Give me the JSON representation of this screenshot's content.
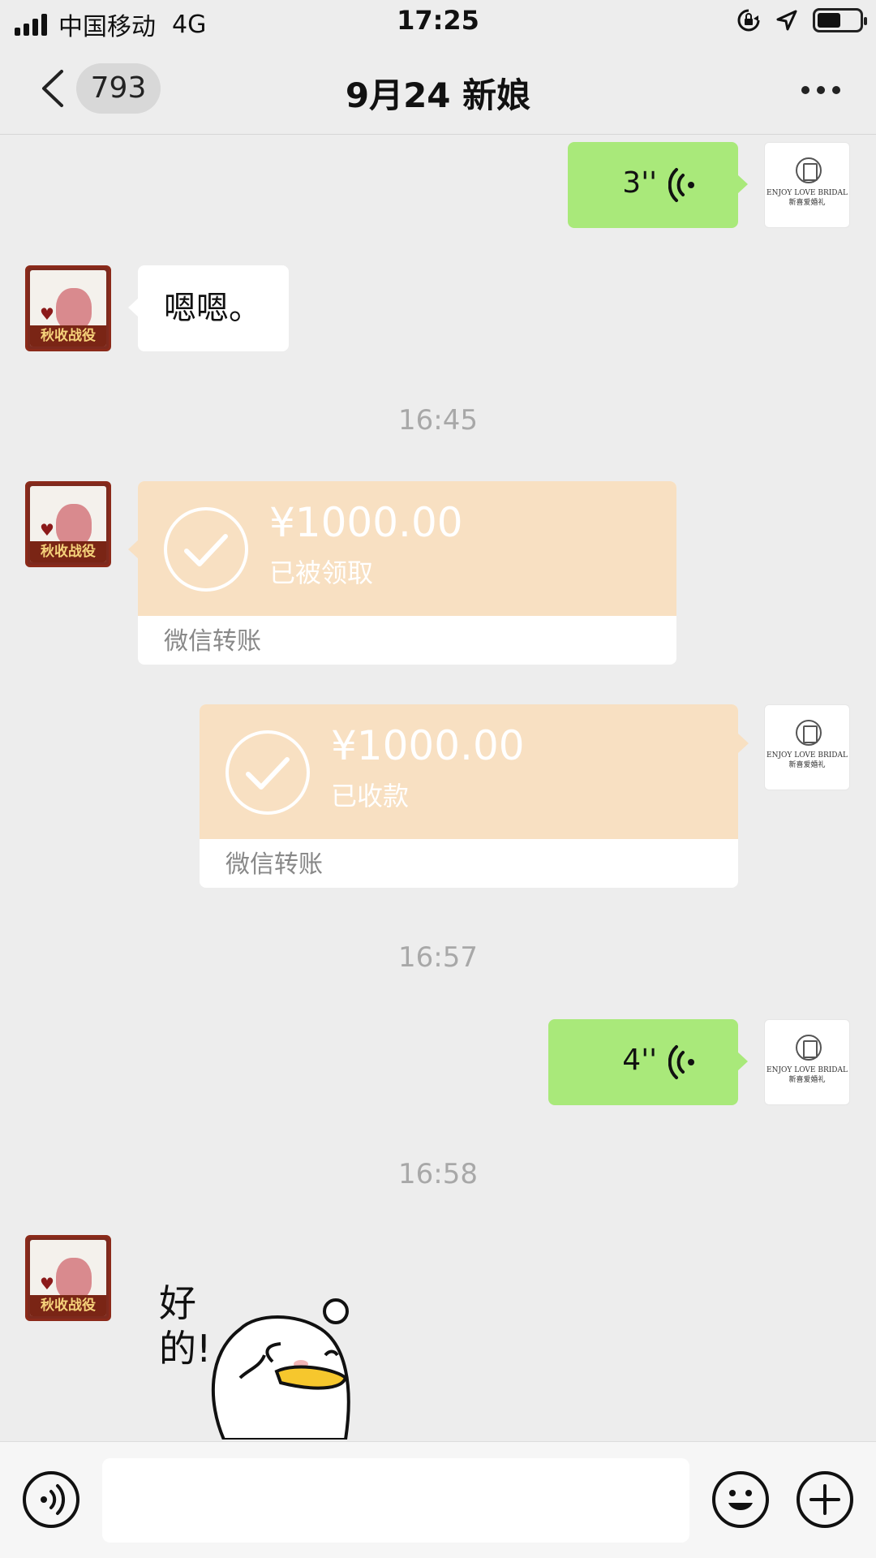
{
  "status_bar": {
    "carrier": "中国移动",
    "network": "4G",
    "time": "17:25"
  },
  "nav": {
    "unread_count": "793",
    "title": "9月24 新娘"
  },
  "avatars": {
    "left_tag": "秋收战役",
    "right_logo_line1": "ENJOY LOVE BRIDAL",
    "right_logo_line2": "新喜爱婚礼"
  },
  "messages": {
    "voice1_duration": "3''",
    "text1": "嗯嗯。",
    "time1": "16:45",
    "transfer1": {
      "amount": "¥1000.00",
      "status": "已被领取",
      "label": "微信转账"
    },
    "transfer2": {
      "amount": "¥1000.00",
      "status": "已收款",
      "label": "微信转账"
    },
    "time2": "16:57",
    "voice2_duration": "4''",
    "time3": "16:58",
    "sticker_text": "好的!"
  },
  "icons": [
    "back-chevron-icon",
    "more-dots-icon",
    "voice-wave-icon",
    "check-icon",
    "voice-input-icon",
    "emoji-icon",
    "plus-icon",
    "signal-icon",
    "battery-icon",
    "location-arrow-icon",
    "orientation-lock-icon"
  ],
  "colors": {
    "background": "#ededed",
    "voice_bubble": "#a9e97a",
    "transfer_bg": "#f8e0c2",
    "timestamp": "#a8a8a8"
  }
}
